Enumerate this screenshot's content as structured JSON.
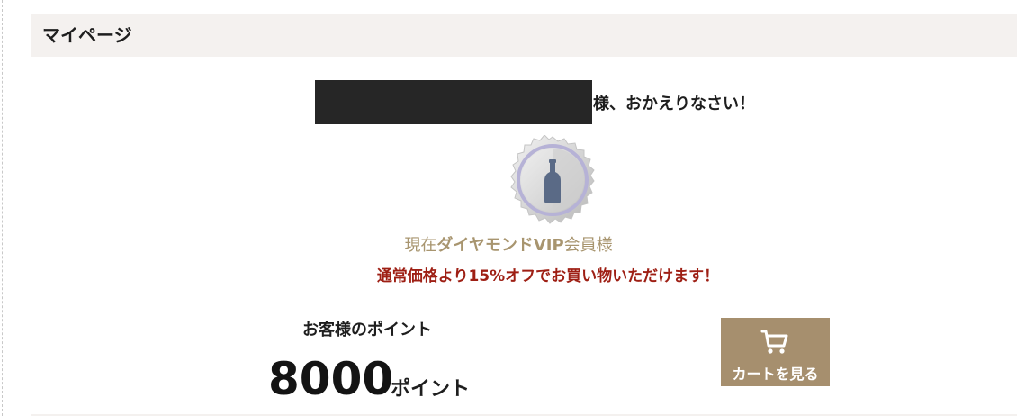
{
  "header": {
    "title": "マイページ"
  },
  "welcome": {
    "suffix": "様、おかえりなさい！"
  },
  "membership": {
    "badge_icon": "bottle-badge-icon",
    "rank_prefix": "現在",
    "rank_name": "ダイヤモンドVIP",
    "rank_suffix": "会員様",
    "discount_message": "通常価格より15%オフでお買い物いただけます！",
    "colors": {
      "rank": "#a8956f",
      "discount": "#9e1f14"
    }
  },
  "points": {
    "label": "お客様のポイント",
    "value": "8000",
    "unit": "ポイント"
  },
  "cart_button": {
    "icon": "cart-icon",
    "label": "カートを見る",
    "color": "#a68f6e"
  }
}
